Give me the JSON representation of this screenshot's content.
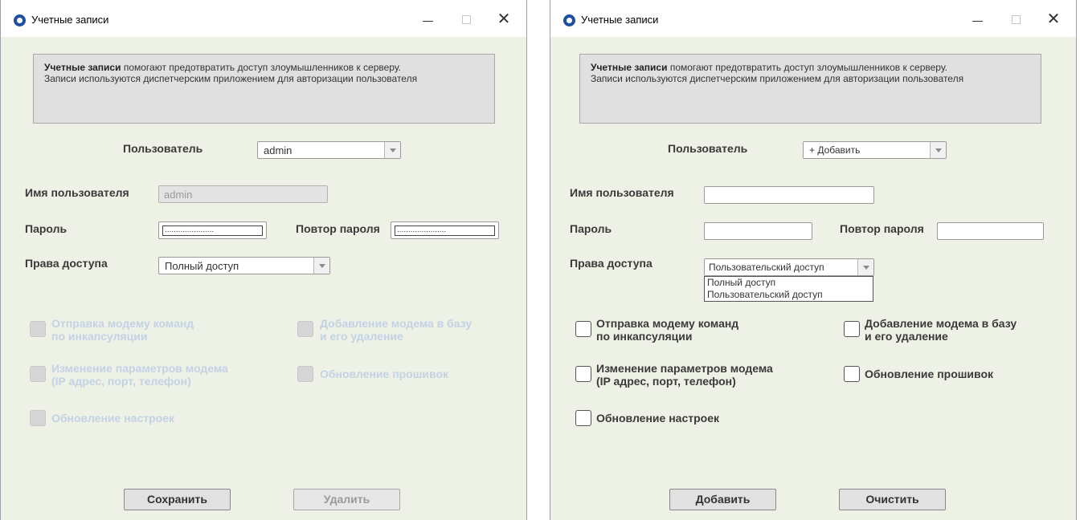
{
  "window_left": {
    "title": "Учетные записи",
    "info": {
      "bold": "Учетные записи",
      "line1_rest": " помогают предотвратить доступ злоумышленников к серверу.",
      "line2": "Записи используются диспетчерским приложением для авторизации пользователя"
    },
    "user_label": "Пользователь",
    "user_value": "admin",
    "username_label": "Имя пользователя",
    "username_value": "admin",
    "password_label": "Пароль",
    "password_mask": "......................",
    "repeat_label": "Повтор пароля",
    "repeat_mask": "......................",
    "rights_label": "Права доступа",
    "rights_value": "Полный доступ",
    "perm_send": [
      "Отправка модему команд",
      "по инкапсуляции"
    ],
    "perm_add": [
      "Добавление модема в базу",
      "и его удаление"
    ],
    "perm_params": [
      "Изменение параметров модема",
      "(IP адрес, порт, телефон)"
    ],
    "perm_firmware": "Обновление прошивок",
    "perm_settings": "Обновление настроек",
    "save_label": "Сохранить",
    "delete_label": "Удалить"
  },
  "window_right": {
    "title": "Учетные записи",
    "info": {
      "bold": "Учетные записи",
      "line1_rest": " помогают предотвратить доступ злоумышленников к серверу.",
      "line2": "Записи используются диспетчерским приложением для авторизации пользователя"
    },
    "user_label": "Пользователь",
    "user_value": "+ Добавить",
    "username_label": "Имя пользователя",
    "password_label": "Пароль",
    "repeat_label": "Повтор пароля",
    "rights_label": "Права доступа",
    "rights_value": "Пользовательский доступ",
    "rights_options": [
      "Полный доступ",
      "Пользовательский доступ"
    ],
    "perm_send": [
      "Отправка модему команд",
      "по инкапсуляции"
    ],
    "perm_add": [
      "Добавление модема в базу",
      "и его удаление"
    ],
    "perm_params": [
      "Изменение параметров модема",
      "(IP адрес, порт, телефон)"
    ],
    "perm_firmware": "Обновление прошивок",
    "perm_settings": "Обновление настроек",
    "add_label": "Добавить",
    "clear_label": "Очистить"
  },
  "icons": {
    "app": "app-logo-icon",
    "minimize": "minimize-icon",
    "maximize": "maximize-icon",
    "close": "close-icon",
    "dropdown": "chevron-down-icon"
  },
  "colors": {
    "window_bg": "#eef1e6",
    "disabled_text": "#c3d2e4"
  }
}
